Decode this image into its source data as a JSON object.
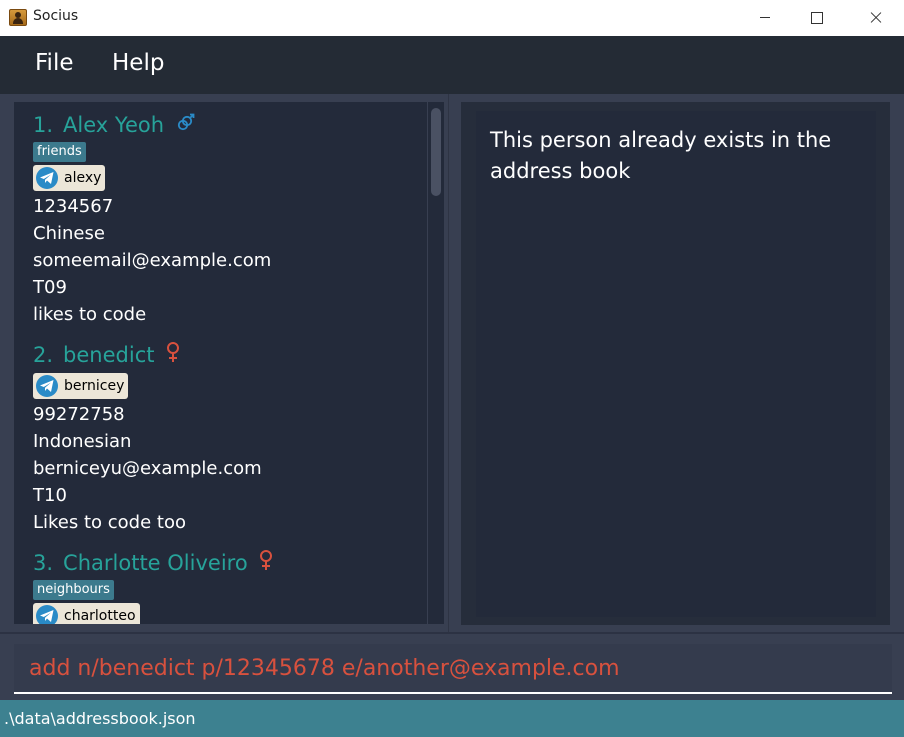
{
  "window": {
    "title": "Socius"
  },
  "menu": {
    "file": "File",
    "help": "Help"
  },
  "persons": [
    {
      "index": "1.",
      "name": "Alex Yeoh",
      "gender_icon": "male-female-icon",
      "tags": [
        "friends"
      ],
      "telegram": "alexy",
      "phone": "1234567",
      "nationality": "Chinese",
      "email": "someemail@example.com",
      "tutorial": "T09",
      "remark": "likes to code"
    },
    {
      "index": "2.",
      "name": "benedict",
      "gender_icon": "female-icon",
      "tags": [],
      "telegram": "bernicey",
      "phone": "99272758",
      "nationality": "Indonesian",
      "email": "berniceyu@example.com",
      "tutorial": "T10",
      "remark": "Likes to code too"
    },
    {
      "index": "3.",
      "name": "Charlotte Oliveiro",
      "gender_icon": "female-icon",
      "tags": [
        "neighbours"
      ],
      "telegram": "charlotteo"
    }
  ],
  "result": {
    "message": "This person already exists in the address book"
  },
  "command": {
    "value": "add n/benedict p/12345678 e/another@example.com"
  },
  "status": {
    "path": ".\\data\\addressbook.json"
  },
  "colors": {
    "name": "#27a39a",
    "tag": "#3c7a8d",
    "error_command": "#d8513e",
    "gender_female": "#d8513e",
    "gender_other": "#2a8bc7",
    "status_bar": "#3d8190"
  }
}
